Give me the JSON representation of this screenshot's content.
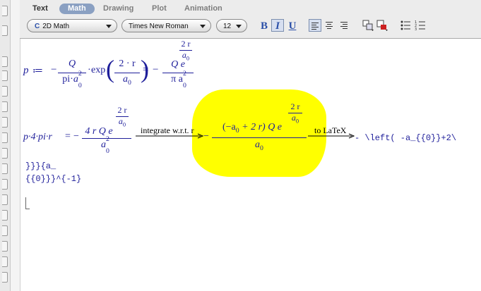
{
  "toolbar": {
    "tabs": [
      "Text",
      "Math",
      "Drawing",
      "Plot",
      "Animation"
    ],
    "active_tab": "Math",
    "mode_combo": "2D Math",
    "font_combo": "Times New Roman",
    "size_combo": "12",
    "bold_label": "B",
    "italic_label": "I",
    "underline_label": "U"
  },
  "doc": {
    "eq1": {
      "lhs": "p",
      "assign": "≔",
      "minus": "−",
      "Q": "Q",
      "pi": "pi",
      "a0": "a",
      "a0_sub": "0",
      "a0_sup": "2",
      "exp": "exp",
      "dot": "·",
      "two_r": "2 · r",
      "eq": "=",
      "Qe": "Q e",
      "two_r_exp": "2 r",
      "pi_a0": "π a",
      "pi_a0_sub": "0",
      "pi_a0_sup": "2"
    },
    "eq2": {
      "lhs": "p·4·pi·r",
      "eq": "=",
      "minus": "−",
      "numer": "4 r Q e",
      "exp_num": "2 r",
      "exp_den": "a",
      "exp_den_sub": "0",
      "den": "a",
      "den_sub": "0",
      "den_sup": "2",
      "arrow1_label": "integrate w.r.t. r",
      "result_numer": "(−a",
      "result_numer_sub": "0",
      "result_numer_tail": "+ 2 r) Q e",
      "result_exp_num": "2 r",
      "result_exp_den": "a",
      "result_exp_den_sub": "0",
      "result_den": "a",
      "result_den_sub": "0",
      "arrow2_label": "to LaTeX",
      "latex_line1": "- \\left( -a_{{0}}+2\\",
      "latex_line2": "}}}{a_",
      "latex_line3": "{{0}}}^{-1}"
    },
    "highlight_color": "#ffff00",
    "math_color": "#1e1e9a"
  }
}
